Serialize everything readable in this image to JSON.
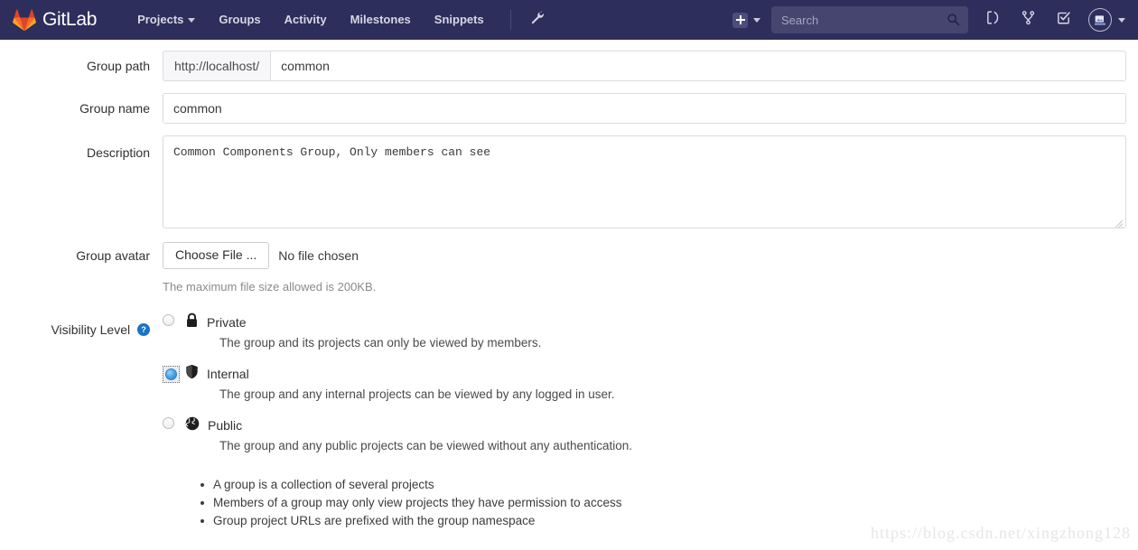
{
  "navbar": {
    "brand_name": "GitLab",
    "brand_icon": "gitlab-fox-logo",
    "links": [
      {
        "label": "Projects",
        "has_caret": true
      },
      {
        "label": "Groups",
        "has_caret": false
      },
      {
        "label": "Activity",
        "has_caret": false
      },
      {
        "label": "Milestones",
        "has_caret": false
      },
      {
        "label": "Snippets",
        "has_caret": false
      }
    ],
    "admin_icon": "wrench-icon",
    "new_icon": "plus-icon",
    "new_caret_icon": "chevron-down-icon",
    "search": {
      "placeholder": "Search",
      "value": "",
      "icon": "search-icon"
    },
    "icons": [
      {
        "name": "issues-icon"
      },
      {
        "name": "merge-requests-icon"
      },
      {
        "name": "todos-icon"
      }
    ],
    "avatar_icon": "user-avatar",
    "avatar_caret_icon": "chevron-down-icon",
    "bg_color": "#2e2e5c",
    "search_bg_color": "#45456f"
  },
  "form": {
    "group_path": {
      "label": "Group path",
      "prefix": "http://localhost/",
      "value": "common"
    },
    "group_name": {
      "label": "Group name",
      "value": "common"
    },
    "description": {
      "label": "Description",
      "value": "Common Components Group, Only members can see"
    },
    "group_avatar": {
      "label": "Group avatar",
      "button_label": "Choose File ...",
      "status_text": "No file chosen",
      "help_text": "The maximum file size allowed is 200KB."
    },
    "visibility": {
      "label": "Visibility Level",
      "help_icon": "help-circle-icon",
      "options": [
        {
          "key": "private",
          "title": "Private",
          "icon": "lock-icon",
          "description": "The group and its projects can only be viewed by members.",
          "selected": false
        },
        {
          "key": "internal",
          "title": "Internal",
          "icon": "shield-icon",
          "description": "The group and any internal projects can be viewed by any logged in user.",
          "selected": true
        },
        {
          "key": "public",
          "title": "Public",
          "icon": "globe-icon",
          "description": "The group and any public projects can be viewed without any authentication.",
          "selected": false
        }
      ],
      "notes": [
        "A group is a collection of several projects",
        "Members of a group may only view projects they have permission to access",
        "Group project URLs are prefixed with the group namespace"
      ]
    }
  },
  "watermark": {
    "text": "https://blog.csdn.net/xingzhong128"
  }
}
